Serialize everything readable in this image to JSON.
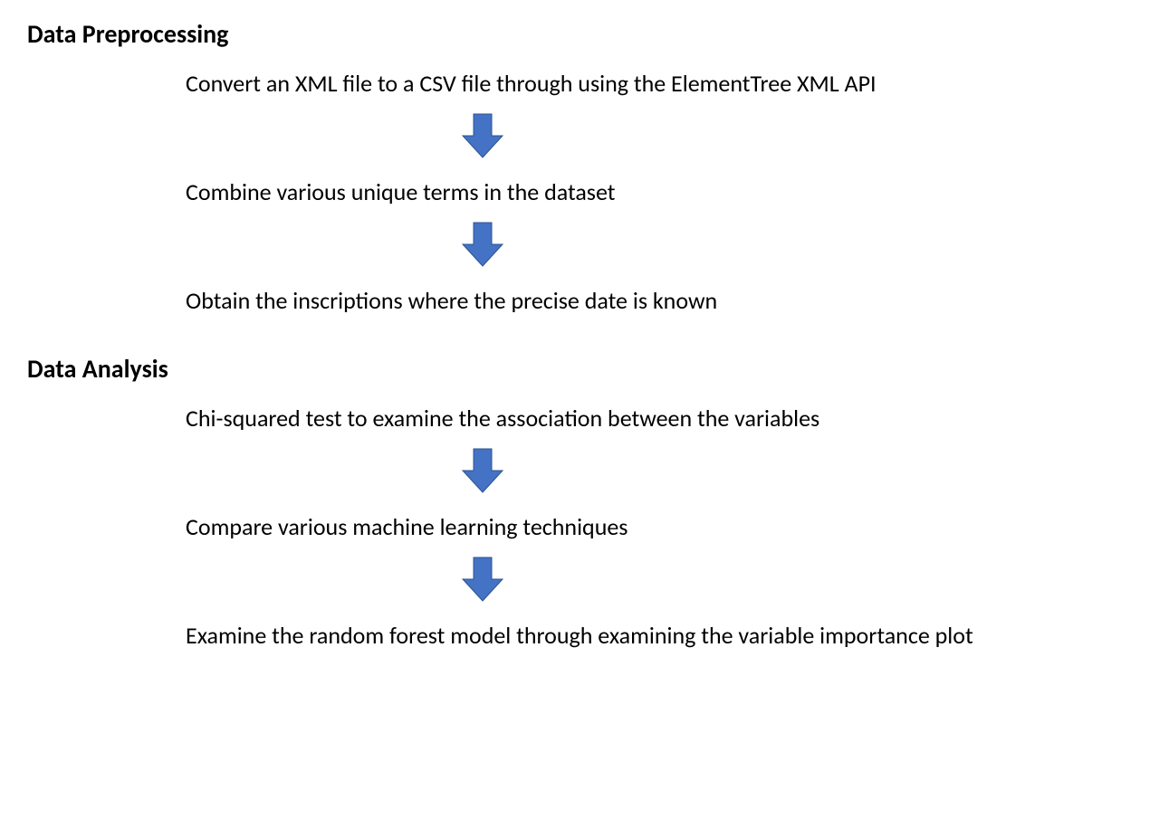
{
  "section1": {
    "heading": "Data Preprocessing",
    "steps": [
      "Convert an XML file to a CSV file through using the ElementTree XML API",
      "Combine various unique terms in the dataset",
      "Obtain the inscriptions where the precise date is known"
    ]
  },
  "section2": {
    "heading": "Data Analysis",
    "steps": [
      "Chi-squared test to examine the association between the variables",
      "Compare various machine learning techniques",
      "Examine the random forest model through examining the variable importance plot"
    ]
  },
  "arrow_color": "#4472C4"
}
